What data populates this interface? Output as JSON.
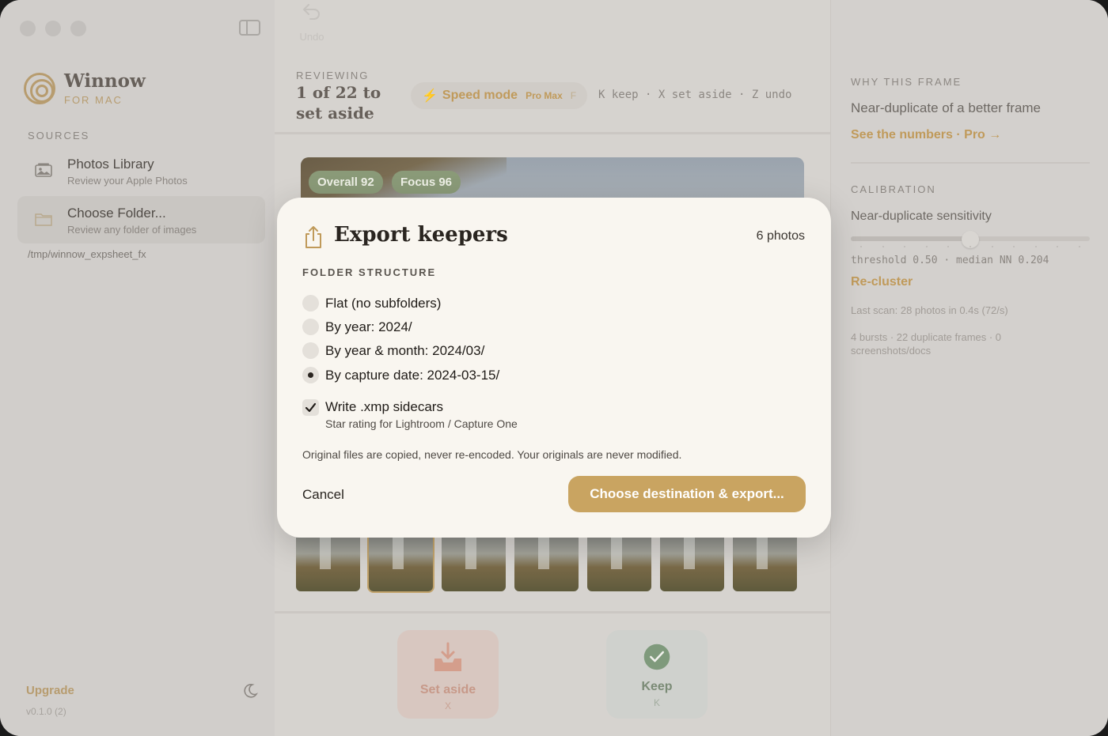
{
  "sidebar": {
    "app_name": "Winnow",
    "app_sub": "FOR MAC",
    "sources_label": "SOURCES",
    "items": [
      {
        "title": "Photos Library",
        "desc": "Review your Apple Photos",
        "icon": "photo-icon"
      },
      {
        "title": "Choose Folder...",
        "desc": "Review any folder of images",
        "icon": "folder-icon"
      }
    ],
    "folder_path": "/tmp/winnow_expsheet_fx",
    "upgrade": "Upgrade",
    "version": "v0.1.0 (2)"
  },
  "header": {
    "reviewing_label": "REVIEWING",
    "reviewing_count": "1 of 22 to set aside",
    "speed_label": "Speed mode",
    "speed_pro": "Pro Max",
    "speed_key": "F",
    "shortcuts": "K keep · X set aside · Z undo"
  },
  "photo": {
    "badges": [
      "Overall 92",
      "Focus 96"
    ]
  },
  "footer": {
    "set_aside": {
      "label": "Set aside",
      "key": "X"
    },
    "undo": {
      "label": "Undo"
    },
    "keep": {
      "label": "Keep",
      "key": "K"
    }
  },
  "right_panel": {
    "why_label": "WHY THIS FRAME",
    "why_text": "Near-duplicate of a better frame",
    "see_numbers": "See the numbers · Pro →",
    "calibration_label": "CALIBRATION",
    "sensitivity_label": "Near-duplicate sensitivity",
    "sensitivity_value": 0.5,
    "threshold_text": "threshold 0.50 · median NN 0.204",
    "recluster": "Re-cluster",
    "last_scan": "Last scan: 28 photos in 0.4s (72/s)",
    "stats": "4 bursts · 22 duplicate frames · 0 screenshots/docs"
  },
  "modal": {
    "title": "Export keepers",
    "count": "6 photos",
    "folder_structure_label": "FOLDER STRUCTURE",
    "options": [
      {
        "label": "Flat (no subfolders)",
        "checked": false
      },
      {
        "label": "By year: 2024/",
        "checked": false
      },
      {
        "label": "By year & month: 2024/03/",
        "checked": false
      },
      {
        "label": "By capture date: 2024-03-15/",
        "checked": true
      }
    ],
    "xmp_label": "Write .xmp sidecars",
    "xmp_sub": "Star rating for Lightroom / Capture One",
    "xmp_checked": true,
    "note": "Original files are copied, never re-encoded. Your originals are never modified.",
    "cancel": "Cancel",
    "primary": "Choose destination & export..."
  },
  "colors": {
    "accent": "#c9a461",
    "modal_bg": "#f9f6f0",
    "dim_bg": "#d6d3cf"
  }
}
